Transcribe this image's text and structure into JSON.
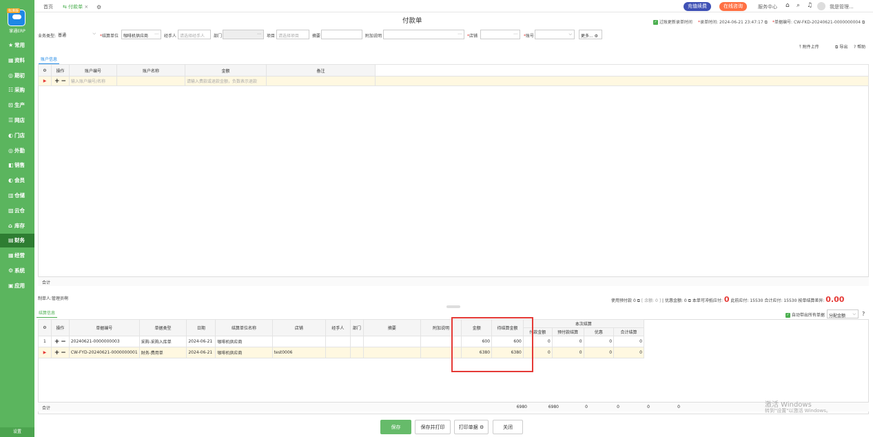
{
  "sidebar": {
    "badge": "标准版",
    "brand": "掌通ERP",
    "items": [
      {
        "label": "常用",
        "icon": "★"
      },
      {
        "label": "资料",
        "icon": "▦"
      },
      {
        "label": "期初",
        "icon": "◎"
      },
      {
        "label": "采购",
        "icon": "☷"
      },
      {
        "label": "生产",
        "icon": "⊡"
      },
      {
        "label": "网店",
        "icon": "☰"
      },
      {
        "label": "门店",
        "icon": "◐"
      },
      {
        "label": "外勤",
        "icon": "◎"
      },
      {
        "label": "销售",
        "icon": "◧"
      },
      {
        "label": "会员",
        "icon": "◐"
      },
      {
        "label": "仓储",
        "icon": "▥"
      },
      {
        "label": "云仓",
        "icon": "▨"
      },
      {
        "label": "库存",
        "icon": "⌂"
      },
      {
        "label": "财务",
        "icon": "▤"
      },
      {
        "label": "经营",
        "icon": "▦"
      },
      {
        "label": "系统",
        "icon": "⚙"
      },
      {
        "label": "应用",
        "icon": "▣"
      }
    ],
    "footer": "设置"
  },
  "topbar": {
    "home_tab": "首页",
    "active_tab": "付款单",
    "recharge": "充值续费",
    "consult": "在线咨询",
    "service": "服务中心",
    "user": "我是管理..."
  },
  "page": {
    "title": "付款单",
    "filter_update_time": "过账更新录单时间",
    "entry_time_label": "录单时间:",
    "entry_time": "2024-06-21 23:47:17",
    "doc_no_label": "单据编号:",
    "doc_no": "CW-FKD-20240621-0000000004"
  },
  "form": {
    "biz_type_label": "业务类型:",
    "biz_type": "普通",
    "settle_unit_label": "结算单位",
    "settle_unit": "咖啡机供应商",
    "handler_label": "经手人",
    "handler_ph": "请选择经手人",
    "dept_label": "部门",
    "project_label": "项目",
    "project_ph": "请选择项目",
    "summary_label": "摘要",
    "extra_label": "附加说明",
    "shop_label": "店铺",
    "account_label": "账号",
    "more": "更多..."
  },
  "tools": {
    "attach": "附件上传",
    "export": "导出",
    "help": "帮助"
  },
  "account_section": {
    "tab": "账户信息",
    "headers": [
      "操作",
      "账户编号",
      "账户名称",
      "金额",
      "备注"
    ],
    "input_ph": "输入账户编号/名称",
    "amount_hint": "请输入费款或退款金额，负数表示退款",
    "total_label": "合计"
  },
  "summary": {
    "maker_label": "制单人:",
    "maker": "管理员啊",
    "prepaid_label": "使用预付款",
    "prepaid": "0",
    "balance_text": "[ 余额: 0 ]",
    "discount_label": "优惠金额:",
    "discount": "0",
    "offset_label": "本单可冲抵应付:",
    "offset": "0",
    "payable_label": "此前应付:",
    "payable": "15530",
    "total_payable_label": "合计应付:",
    "total_payable": "15530",
    "diff_label": "按单结算差异:",
    "diff": "0.00"
  },
  "settle_section": {
    "tab": "结算信息",
    "auto_fill": "自动带出所有单据",
    "distribute": "分配金额",
    "headers": [
      "操作",
      "单据编号",
      "单据类型",
      "日期",
      "结算单位名称",
      "店铺",
      "经手人",
      "部门",
      "摘要",
      "附加说明",
      "金额",
      "待结算金额"
    ],
    "group_header": "本次结算",
    "sub_headers": [
      "付款金额",
      "预付款结算",
      "优惠",
      "合计结算"
    ],
    "rows": [
      {
        "idx": "1",
        "doc_no": "20240621-0000000003",
        "type": "采购-采购入库单",
        "date": "2024-06-21",
        "unit": "咖啡机供应商",
        "shop": "",
        "amount": "600",
        "pending": "600",
        "pay": "0",
        "prepay": "0",
        "discount": "0",
        "total": "0"
      },
      {
        "idx": "",
        "doc_no": "CW-FYD-20240621-0000000001",
        "type": "财务-费用单",
        "date": "2024-06-21",
        "unit": "咖啡机供应商",
        "shop": "test0006",
        "amount": "6380",
        "pending": "6380",
        "pay": "0",
        "prepay": "0",
        "discount": "0",
        "total": "0"
      }
    ],
    "total_label": "合计",
    "totals": {
      "amount": "6980",
      "pending": "6980",
      "pay": "0",
      "prepay": "0",
      "discount": "0",
      "total": "0"
    }
  },
  "buttons": {
    "save": "保存",
    "save_print": "保存并打印",
    "print": "打印单据",
    "close": "关闭"
  },
  "watermark": {
    "line1": "激活 Windows",
    "line2": "转到\"设置\"以激活 Windows。"
  }
}
